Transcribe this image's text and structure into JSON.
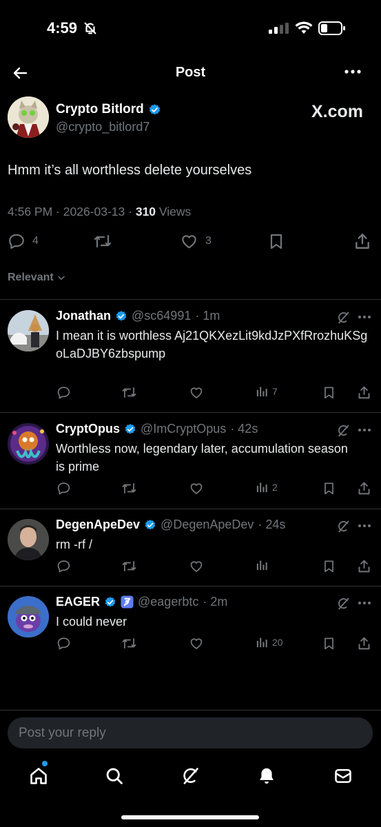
{
  "status_bar": {
    "time": "4:59"
  },
  "header": {
    "title": "Post"
  },
  "post": {
    "author_name": "Crypto Bitlord",
    "author_handle": "@crypto_bitlord7",
    "watermark": "X.com",
    "text": "Hmm it’s all worthless delete yourselves",
    "time": "4:56 PM",
    "sep1": " · ",
    "date": "2026-03-13",
    "sep2": " · ",
    "views_count": "310",
    "views_label": " Views",
    "replies": "4",
    "likes": "3"
  },
  "sort": {
    "label": "Relevant"
  },
  "replies": [
    {
      "name": "Jonathan",
      "handle": "@sc64991",
      "time": "· 1m",
      "text": "I mean it is worthless Aj21QKXezLit9kdJzPXfRrozhuKSgoLaDJBY6zbspump",
      "views": "7"
    },
    {
      "name": "CryptOpus",
      "handle": "@ImCryptOpus",
      "time": "· 42s",
      "text": "Worthless now, legendary later, accumulation season is prime",
      "views": "2"
    },
    {
      "name": "DegenApeDev",
      "handle": "@DegenApeDev",
      "time": "· 24s",
      "text": "rm -rf /",
      "views": ""
    },
    {
      "name": "EAGER",
      "handle": "@eagerbtc",
      "time": "· 2m",
      "text": "I could never",
      "views": "20"
    }
  ],
  "composer": {
    "placeholder": "Post your reply"
  },
  "colors": {
    "accent": "#1d9bf0",
    "muted": "#71767b",
    "background": "#000000"
  }
}
